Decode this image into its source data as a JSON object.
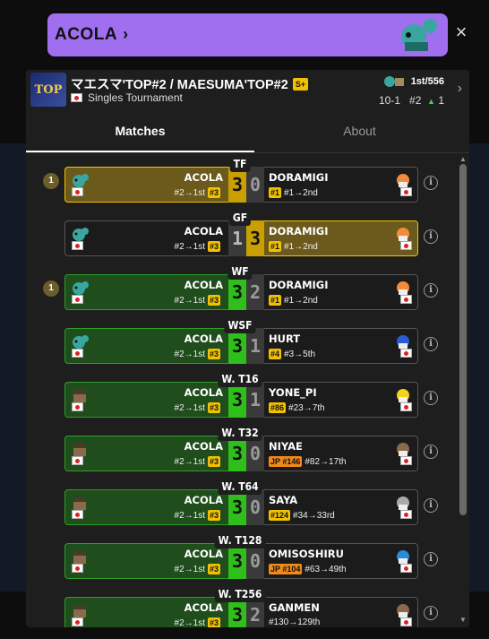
{
  "banner": {
    "title": "ACOLA",
    "chevron": "chevron-right-icon"
  },
  "tournament": {
    "logo_text": "TOP",
    "title": "マエスマ'TOP#2 / MAESUMA'TOP#2",
    "tier": "S+",
    "type": "Singles Tournament",
    "placement": "1st/556",
    "record": "10-1",
    "seed": "#2",
    "seed_change": "1"
  },
  "tabs": [
    {
      "label": "Matches",
      "active": true
    },
    {
      "label": "About",
      "active": false
    }
  ],
  "matches": [
    {
      "round": "TF",
      "dot": "1",
      "left": {
        "name": "ACOLA",
        "seed_text": "#2→1st",
        "badge": "#3"
      },
      "score_l": "3",
      "score_r": "0",
      "right": {
        "name": "DORAMIGI",
        "badge": "#1",
        "seed_text": "#1→2nd"
      },
      "winner": "left",
      "style": "gold"
    },
    {
      "round": "GF",
      "dot": "",
      "left": {
        "name": "ACOLA",
        "seed_text": "#2→1st",
        "badge": "#3"
      },
      "score_l": "1",
      "score_r": "3",
      "right": {
        "name": "DORAMIGI",
        "badge": "#1",
        "seed_text": "#1→2nd"
      },
      "winner": "right",
      "style": "gold"
    },
    {
      "round": "WF",
      "dot": "1",
      "left": {
        "name": "ACOLA",
        "seed_text": "#2→1st",
        "badge": "#3"
      },
      "score_l": "3",
      "score_r": "2",
      "right": {
        "name": "DORAMIGI",
        "badge": "#1",
        "seed_text": "#1→2nd"
      },
      "winner": "left",
      "style": "green"
    },
    {
      "round": "WSF",
      "dot": "",
      "left": {
        "name": "ACOLA",
        "seed_text": "#2→1st",
        "badge": "#3"
      },
      "score_l": "3",
      "score_r": "1",
      "right": {
        "name": "HURT",
        "badge": "#4",
        "seed_text": "#3→5th"
      },
      "winner": "left",
      "style": "green"
    },
    {
      "round": "W. T16",
      "dot": "",
      "left": {
        "name": "ACOLA",
        "seed_text": "#2→1st",
        "badge": "#3"
      },
      "score_l": "3",
      "score_r": "1",
      "right": {
        "name": "YONE_PI",
        "badge": "#86",
        "seed_text": "#23→7th"
      },
      "winner": "left",
      "style": "green"
    },
    {
      "round": "W. T32",
      "dot": "",
      "left": {
        "name": "ACOLA",
        "seed_text": "#2→1st",
        "badge": "#3"
      },
      "score_l": "3",
      "score_r": "0",
      "right": {
        "name": "NIYAE",
        "badge": "JP #146",
        "badge_style": "orange",
        "seed_text": "#82→17th"
      },
      "winner": "left",
      "style": "green"
    },
    {
      "round": "W. T64",
      "dot": "",
      "left": {
        "name": "ACOLA",
        "seed_text": "#2→1st",
        "badge": "#3"
      },
      "score_l": "3",
      "score_r": "0",
      "right": {
        "name": "SAYA",
        "badge": "#124",
        "seed_text": "#34→33rd"
      },
      "winner": "left",
      "style": "green"
    },
    {
      "round": "W. T128",
      "dot": "",
      "left": {
        "name": "ACOLA",
        "seed_text": "#2→1st",
        "badge": "#3"
      },
      "score_l": "3",
      "score_r": "0",
      "right": {
        "name": "OMISOSHIRU",
        "badge": "JP #104",
        "badge_style": "orange",
        "seed_text": "#63→49th"
      },
      "winner": "left",
      "style": "green"
    },
    {
      "round": "W. T256",
      "dot": "",
      "left": {
        "name": "ACOLA",
        "seed_text": "#2→1st",
        "badge": "#3"
      },
      "score_l": "3",
      "score_r": "2",
      "right": {
        "name": "GANMEN",
        "badge": "",
        "seed_text": "#130→129th"
      },
      "winner": "left",
      "style": "green"
    }
  ],
  "colors": {
    "banner": "#a06ff0",
    "gold": "#f2c200",
    "green": "#2fbf1a",
    "panel": "#1e1e1e"
  }
}
